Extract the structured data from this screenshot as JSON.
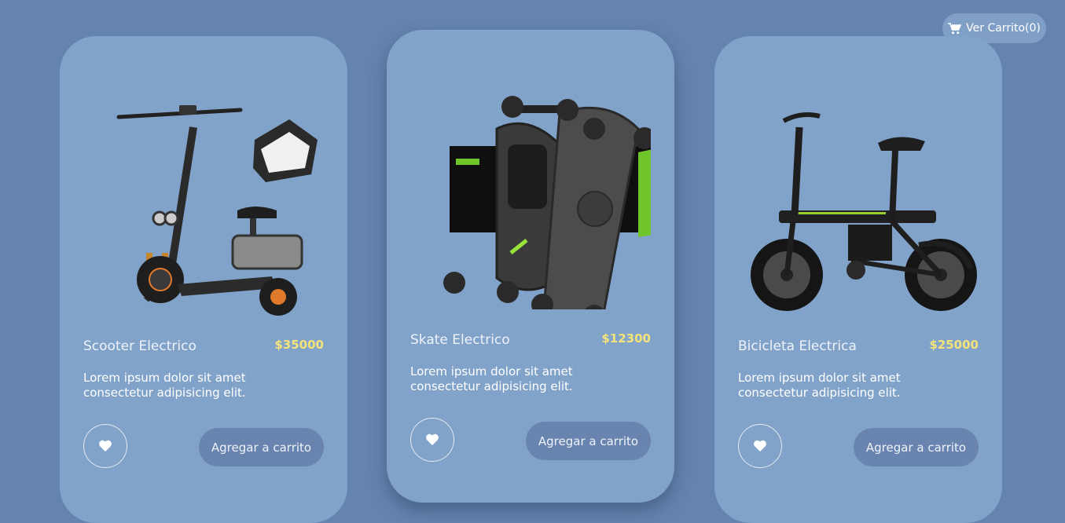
{
  "header": {
    "cart_label": "Ver Carrito(0)"
  },
  "products": [
    {
      "name": "Scooter Electrico",
      "price": "$35000",
      "description": "Lorem ipsum dolor sit amet consectetur adipisicing elit.",
      "add_label": "Agregar a carrito",
      "image_icon": "scooter-image"
    },
    {
      "name": "Skate Electrico",
      "price": "$12300",
      "description": "Lorem ipsum dolor sit amet consectetur adipisicing elit.",
      "add_label": "Agregar a carrito",
      "image_icon": "skateboard-image"
    },
    {
      "name": "Bicicleta Electrica",
      "price": "$25000",
      "description": "Lorem ipsum dolor sit amet consectetur adipisicing elit.",
      "add_label": "Agregar a carrito",
      "image_icon": "ebike-image"
    }
  ],
  "colors": {
    "background": "#6483ae",
    "card": "#82a3c9",
    "price": "#f4e27a",
    "button": "#6884af"
  }
}
